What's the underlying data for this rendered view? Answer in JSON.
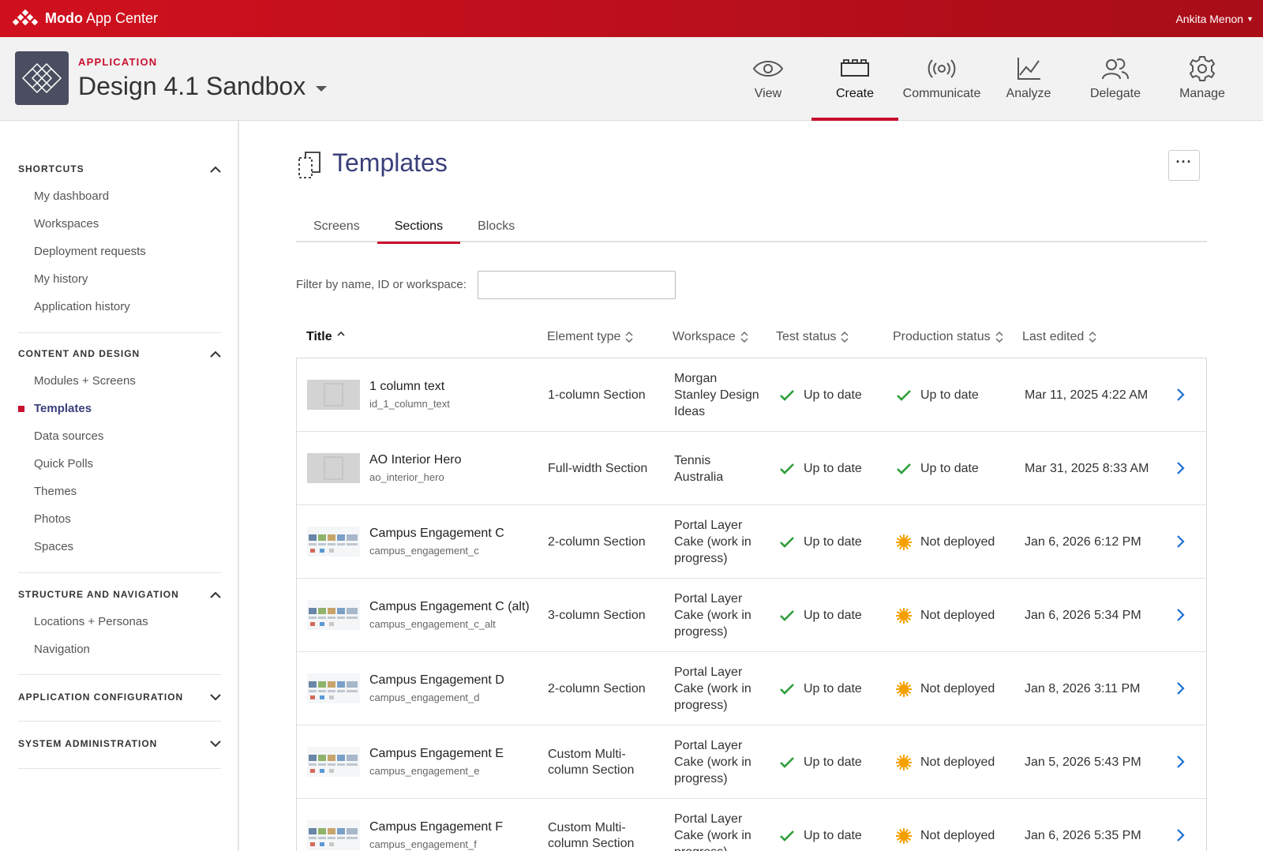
{
  "topbar": {
    "brand_bold": "Modo",
    "brand_rest": " App Center",
    "user_name": "Ankita Menon"
  },
  "app": {
    "label": "APPLICATION",
    "title": "Design 4.1 Sandbox"
  },
  "main_nav": [
    {
      "label": "View",
      "icon": "eye-icon",
      "active": false
    },
    {
      "label": "Create",
      "icon": "blocks-icon",
      "active": true
    },
    {
      "label": "Communicate",
      "icon": "broadcast-icon",
      "active": false
    },
    {
      "label": "Analyze",
      "icon": "line-chart-icon",
      "active": false
    },
    {
      "label": "Delegate",
      "icon": "users-icon",
      "active": false
    },
    {
      "label": "Manage",
      "icon": "gear-icon",
      "active": false
    }
  ],
  "sidebar": {
    "sections": [
      {
        "heading": "SHORTCUTS",
        "expanded": true,
        "items": [
          "My dashboard",
          "Workspaces",
          "Deployment requests",
          "My history",
          "Application history"
        ]
      },
      {
        "heading": "CONTENT AND DESIGN",
        "expanded": true,
        "items": [
          "Modules + Screens",
          "Templates",
          "Data sources",
          "Quick Polls",
          "Themes",
          "Photos",
          "Spaces"
        ],
        "active_item": "Templates"
      },
      {
        "heading": "STRUCTURE AND NAVIGATION",
        "expanded": true,
        "items": [
          "Locations + Personas",
          "Navigation"
        ]
      },
      {
        "heading": "APPLICATION CONFIGURATION",
        "expanded": false,
        "items": []
      },
      {
        "heading": "SYSTEM ADMINISTRATION",
        "expanded": false,
        "items": []
      }
    ]
  },
  "page": {
    "title": "Templates",
    "more_label": "···",
    "tabs": [
      {
        "label": "Screens",
        "active": false
      },
      {
        "label": "Sections",
        "active": true
      },
      {
        "label": "Blocks",
        "active": false
      }
    ],
    "filter_label": "Filter by name, ID or workspace:",
    "filter_value": ""
  },
  "table": {
    "columns": [
      "Title",
      "Element type",
      "Workspace",
      "Test status",
      "Production status",
      "Last edited"
    ],
    "rows": [
      {
        "title": "1 column text",
        "id": "id_1_column_text",
        "type": "1-column Section",
        "workspace": "Morgan Stanley Design Ideas",
        "test": "Up to date",
        "prod": "Up to date",
        "prod_state": "ok",
        "edited": "Mar 11, 2025 4:22 AM",
        "thumb": "plain"
      },
      {
        "title": "AO Interior Hero",
        "id": "ao_interior_hero",
        "type": "Full-width Section",
        "workspace": "Tennis Australia",
        "test": "Up to date",
        "prod": "Up to date",
        "prod_state": "ok",
        "edited": "Mar 31, 2025 8:33 AM",
        "thumb": "plain"
      },
      {
        "title": "Campus Engagement C",
        "id": "campus_engagement_c",
        "type": "2-column Section",
        "workspace": "Portal Layer Cake (work in progress)",
        "test": "Up to date",
        "prod": "Not deployed",
        "prod_state": "pending",
        "edited": "Jan 6, 2026 6:12 PM",
        "thumb": "cards"
      },
      {
        "title": "Campus Engagement C (alt)",
        "id": "campus_engagement_c_alt",
        "type": "3-column Section",
        "workspace": "Portal Layer Cake (work in progress)",
        "test": "Up to date",
        "prod": "Not deployed",
        "prod_state": "pending",
        "edited": "Jan 6, 2026 5:34 PM",
        "thumb": "cards"
      },
      {
        "title": "Campus Engagement D",
        "id": "campus_engagement_d",
        "type": "2-column Section",
        "workspace": "Portal Layer Cake (work in progress)",
        "test": "Up to date",
        "prod": "Not deployed",
        "prod_state": "pending",
        "edited": "Jan 8, 2026 3:11 PM",
        "thumb": "cards"
      },
      {
        "title": "Campus Engagement E",
        "id": "campus_engagement_e",
        "type": "Custom Multi-column Section",
        "workspace": "Portal Layer Cake (work in progress)",
        "test": "Up to date",
        "prod": "Not deployed",
        "prod_state": "pending",
        "edited": "Jan 5, 2026 5:43 PM",
        "thumb": "cards"
      },
      {
        "title": "Campus Engagement F",
        "id": "campus_engagement_f",
        "type": "Custom Multi-column Section",
        "workspace": "Portal Layer Cake (work in progress)",
        "test": "Up to date",
        "prod": "Not deployed",
        "prod_state": "pending",
        "edited": "Jan 6, 2026 5:35 PM",
        "thumb": "cards"
      }
    ]
  },
  "colors": {
    "brand_red": "#c8102e",
    "title_indigo": "#3a3f7a",
    "check_green": "#2e9e3a",
    "pending_orange": "#f5a000",
    "link_blue": "#1a6fd1"
  }
}
